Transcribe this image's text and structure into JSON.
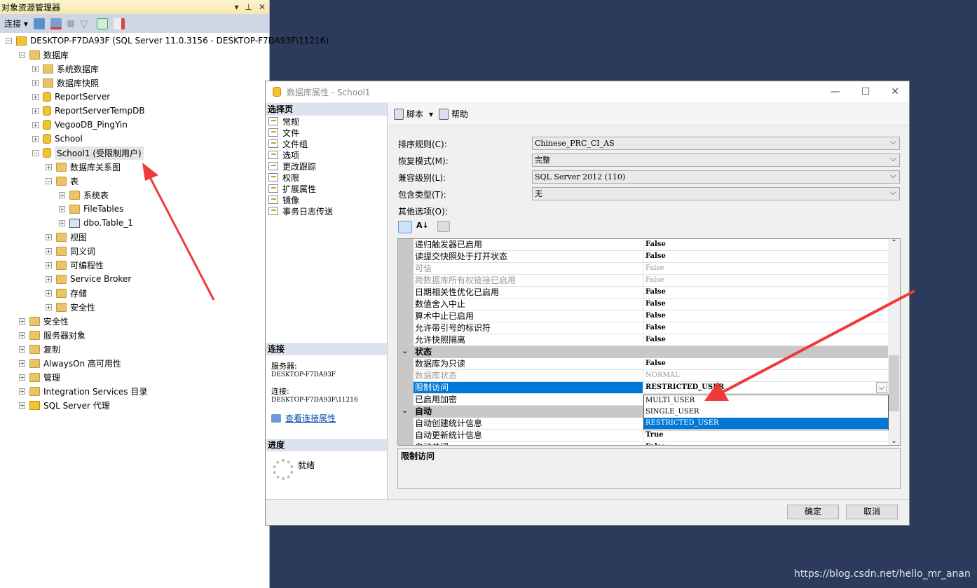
{
  "object_explorer": {
    "title": "对象资源管理器",
    "connect_label": "连接",
    "tree": [
      {
        "label": "DESKTOP-F7DA93F (SQL Server 11.0.3156 - DESKTOP-F7DA93F\\11216)",
        "level": 0,
        "icon": "server-icon",
        "expanded": true
      },
      {
        "label": "数据库",
        "level": 1,
        "icon": "folder-icon",
        "expanded": true
      },
      {
        "label": "系统数据库",
        "level": 2,
        "icon": "folder-icon"
      },
      {
        "label": "数据库快照",
        "level": 2,
        "icon": "folder-icon"
      },
      {
        "label": "ReportServer",
        "level": 2,
        "icon": "database-icon"
      },
      {
        "label": "ReportServerTempDB",
        "level": 2,
        "icon": "database-icon"
      },
      {
        "label": "VegooDB_PingYin",
        "level": 2,
        "icon": "database-icon"
      },
      {
        "label": "School",
        "level": 2,
        "icon": "database-icon"
      },
      {
        "label": "School1 (受限制用户)",
        "level": 2,
        "icon": "database-icon",
        "expanded": true,
        "selected": true
      },
      {
        "label": "数据库关系图",
        "level": 3,
        "icon": "folder-icon"
      },
      {
        "label": "表",
        "level": 3,
        "icon": "folder-icon",
        "expanded": true
      },
      {
        "label": "系统表",
        "level": 4,
        "icon": "folder-icon"
      },
      {
        "label": "FileTables",
        "level": 4,
        "icon": "folder-icon"
      },
      {
        "label": "dbo.Table_1",
        "level": 4,
        "icon": "table-icon"
      },
      {
        "label": "视图",
        "level": 3,
        "icon": "folder-icon"
      },
      {
        "label": "同义词",
        "level": 3,
        "icon": "folder-icon"
      },
      {
        "label": "可编程性",
        "level": 3,
        "icon": "folder-icon"
      },
      {
        "label": "Service Broker",
        "level": 3,
        "icon": "folder-icon"
      },
      {
        "label": "存储",
        "level": 3,
        "icon": "folder-icon"
      },
      {
        "label": "安全性",
        "level": 3,
        "icon": "folder-icon"
      },
      {
        "label": "安全性",
        "level": 1,
        "icon": "folder-icon"
      },
      {
        "label": "服务器对象",
        "level": 1,
        "icon": "folder-icon"
      },
      {
        "label": "复制",
        "level": 1,
        "icon": "folder-icon"
      },
      {
        "label": "AlwaysOn 高可用性",
        "level": 1,
        "icon": "folder-icon"
      },
      {
        "label": "管理",
        "level": 1,
        "icon": "folder-icon"
      },
      {
        "label": "Integration Services 目录",
        "level": 1,
        "icon": "folder-icon"
      },
      {
        "label": "SQL Server 代理",
        "level": 1,
        "icon": "agent-icon"
      }
    ]
  },
  "dialog": {
    "title": "数据库属性 - School1",
    "select_page": "选择页",
    "pages": [
      "常规",
      "文件",
      "文件组",
      "选项",
      "更改跟踪",
      "权限",
      "扩展属性",
      "镜像",
      "事务日志传送"
    ],
    "connection": {
      "header": "连接",
      "server_label": "服务器:",
      "server": "DESKTOP-F7DA93F",
      "conn_label": "连接:",
      "conn": "DESKTOP-F7DA93F\\11216",
      "view_link": "查看连接属性"
    },
    "progress": {
      "header": "进度",
      "status": "就绪"
    },
    "toolbar": {
      "script": "脚本",
      "help": "帮助"
    },
    "fields": [
      {
        "label": "排序规则(C):",
        "value": "Chinese_PRC_CI_AS"
      },
      {
        "label": "恢复模式(M):",
        "value": "完整"
      },
      {
        "label": "兼容级别(L):",
        "value": "SQL Server 2012 (110)"
      },
      {
        "label": "包含类型(T):",
        "value": "无"
      }
    ],
    "other_options": "其他选项(O):",
    "grid": [
      {
        "name": "递归触发器已启用",
        "value": "False"
      },
      {
        "name": "读提交快照处于打开状态",
        "value": "False"
      },
      {
        "name": "可信",
        "value": "False",
        "disabled": true
      },
      {
        "name": "跨数据库所有权链接已启用",
        "value": "False",
        "disabled": true
      },
      {
        "name": "日期相关性优化已启用",
        "value": "False"
      },
      {
        "name": "数值舍入中止",
        "value": "False"
      },
      {
        "name": "算术中止已启用",
        "value": "False"
      },
      {
        "name": "允许带引号的标识符",
        "value": "False"
      },
      {
        "name": "允许快照隔离",
        "value": "False"
      },
      {
        "name": "状态",
        "category": true
      },
      {
        "name": "数据库为只读",
        "value": "False"
      },
      {
        "name": "数据库状态",
        "value": "NORMAL",
        "disabled": true
      },
      {
        "name": "限制访问",
        "value": "RESTRICTED_USER",
        "selected": true
      },
      {
        "name": "已启用加密",
        "value": ""
      },
      {
        "name": "自动",
        "category": true
      },
      {
        "name": "自动创建统计信息",
        "value": "True"
      },
      {
        "name": "自动更新统计信息",
        "value": "True"
      },
      {
        "name": "自动关闭",
        "value": "False"
      }
    ],
    "dropdown_options": [
      "MULTI_USER",
      "SINGLE_USER",
      "RESTRICTED_USER"
    ],
    "dropdown_selected": "RESTRICTED_USER",
    "description_title": "限制访问",
    "ok": "确定",
    "cancel": "取消"
  },
  "watermark": "https://blog.csdn.net/hello_mr_anan",
  "colors": {
    "selection": "#0078d7",
    "annotation_arrow": "#f03a3a",
    "desktop": "#2c3b5b"
  }
}
